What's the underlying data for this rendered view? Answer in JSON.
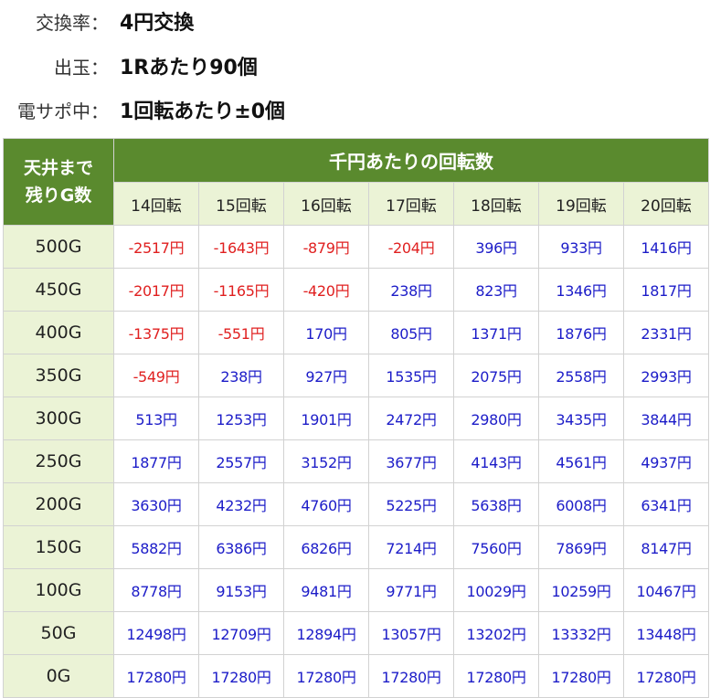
{
  "info": [
    {
      "label": "交換率：",
      "value": "4円交換"
    },
    {
      "label": "出玉：",
      "value": "1Rあたり90個"
    },
    {
      "label": "電サポ中：",
      "value": "1回転あたり±0個"
    }
  ],
  "table": {
    "corner_line1": "天井まで",
    "corner_line2": "残りG数",
    "top_header": "千円あたりの回転数",
    "columns": [
      "14回転",
      "15回転",
      "16回転",
      "17回転",
      "18回転",
      "19回転",
      "20回転"
    ],
    "rows": [
      {
        "label": "500G",
        "values": [
          "-2517円",
          "-1643円",
          "-879円",
          "-204円",
          "396円",
          "933円",
          "1416円"
        ]
      },
      {
        "label": "450G",
        "values": [
          "-2017円",
          "-1165円",
          "-420円",
          "238円",
          "823円",
          "1346円",
          "1817円"
        ]
      },
      {
        "label": "400G",
        "values": [
          "-1375円",
          "-551円",
          "170円",
          "805円",
          "1371円",
          "1876円",
          "2331円"
        ]
      },
      {
        "label": "350G",
        "values": [
          "-549円",
          "238円",
          "927円",
          "1535円",
          "2075円",
          "2558円",
          "2993円"
        ]
      },
      {
        "label": "300G",
        "values": [
          "513円",
          "1253円",
          "1901円",
          "2472円",
          "2980円",
          "3435円",
          "3844円"
        ]
      },
      {
        "label": "250G",
        "values": [
          "1877円",
          "2557円",
          "3152円",
          "3677円",
          "4143円",
          "4561円",
          "4937円"
        ]
      },
      {
        "label": "200G",
        "values": [
          "3630円",
          "4232円",
          "4760円",
          "5225円",
          "5638円",
          "6008円",
          "6341円"
        ]
      },
      {
        "label": "150G",
        "values": [
          "5882円",
          "6386円",
          "6826円",
          "7214円",
          "7560円",
          "7869円",
          "8147円"
        ]
      },
      {
        "label": "100G",
        "values": [
          "8778円",
          "9153円",
          "9481円",
          "9771円",
          "10029円",
          "10259円",
          "10467円"
        ]
      },
      {
        "label": "50G",
        "values": [
          "12498円",
          "12709円",
          "12894円",
          "13057円",
          "13202円",
          "13332円",
          "13448円"
        ]
      },
      {
        "label": "0G",
        "values": [
          "17280円",
          "17280円",
          "17280円",
          "17280円",
          "17280円",
          "17280円",
          "17280円"
        ]
      }
    ]
  },
  "colors": {
    "header_green": "#5a8a2e",
    "header_light": "#ebf3d6",
    "negative": "#e02020",
    "positive": "#1c1cc8"
  }
}
